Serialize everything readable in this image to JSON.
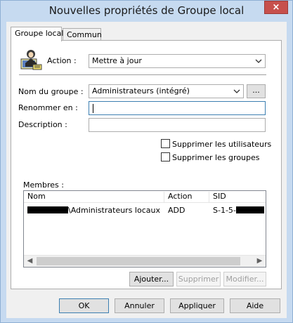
{
  "window": {
    "title": "Nouvelles propriétés de Groupe local",
    "close_glyph": "×"
  },
  "tabs": [
    {
      "label": "Groupe local",
      "active": true
    },
    {
      "label": "Commun",
      "active": false
    }
  ],
  "icon": {
    "name": "local-group-icon"
  },
  "action": {
    "label": "Action :",
    "value": "Mettre à jour"
  },
  "group_name": {
    "label": "Nom du groupe :",
    "value": "Administrateurs (intégré)",
    "browse_label": "..."
  },
  "rename": {
    "label": "Renommer en :",
    "value": ""
  },
  "description": {
    "label": "Description :",
    "value": ""
  },
  "checkboxes": {
    "delete_users": {
      "label": "Supprimer les utilisateurs",
      "checked": false
    },
    "delete_groups": {
      "label": "Supprimer les groupes",
      "checked": false
    }
  },
  "members": {
    "label": "Membres :",
    "columns": [
      "Nom",
      "Action",
      "SID"
    ],
    "rows": [
      {
        "name": "\\Administrateurs locaux",
        "action": "ADD",
        "sid": "S-1-5-"
      }
    ]
  },
  "member_buttons": {
    "add": "Ajouter...",
    "remove": "Supprimer",
    "modify": "Modifier..."
  },
  "dialog_buttons": {
    "ok": "OK",
    "cancel": "Annuler",
    "apply": "Appliquer",
    "help": "Aide"
  },
  "colors": {
    "frame": "#c6daf0",
    "close": "#c7504c",
    "focus": "#3c7fb1"
  }
}
